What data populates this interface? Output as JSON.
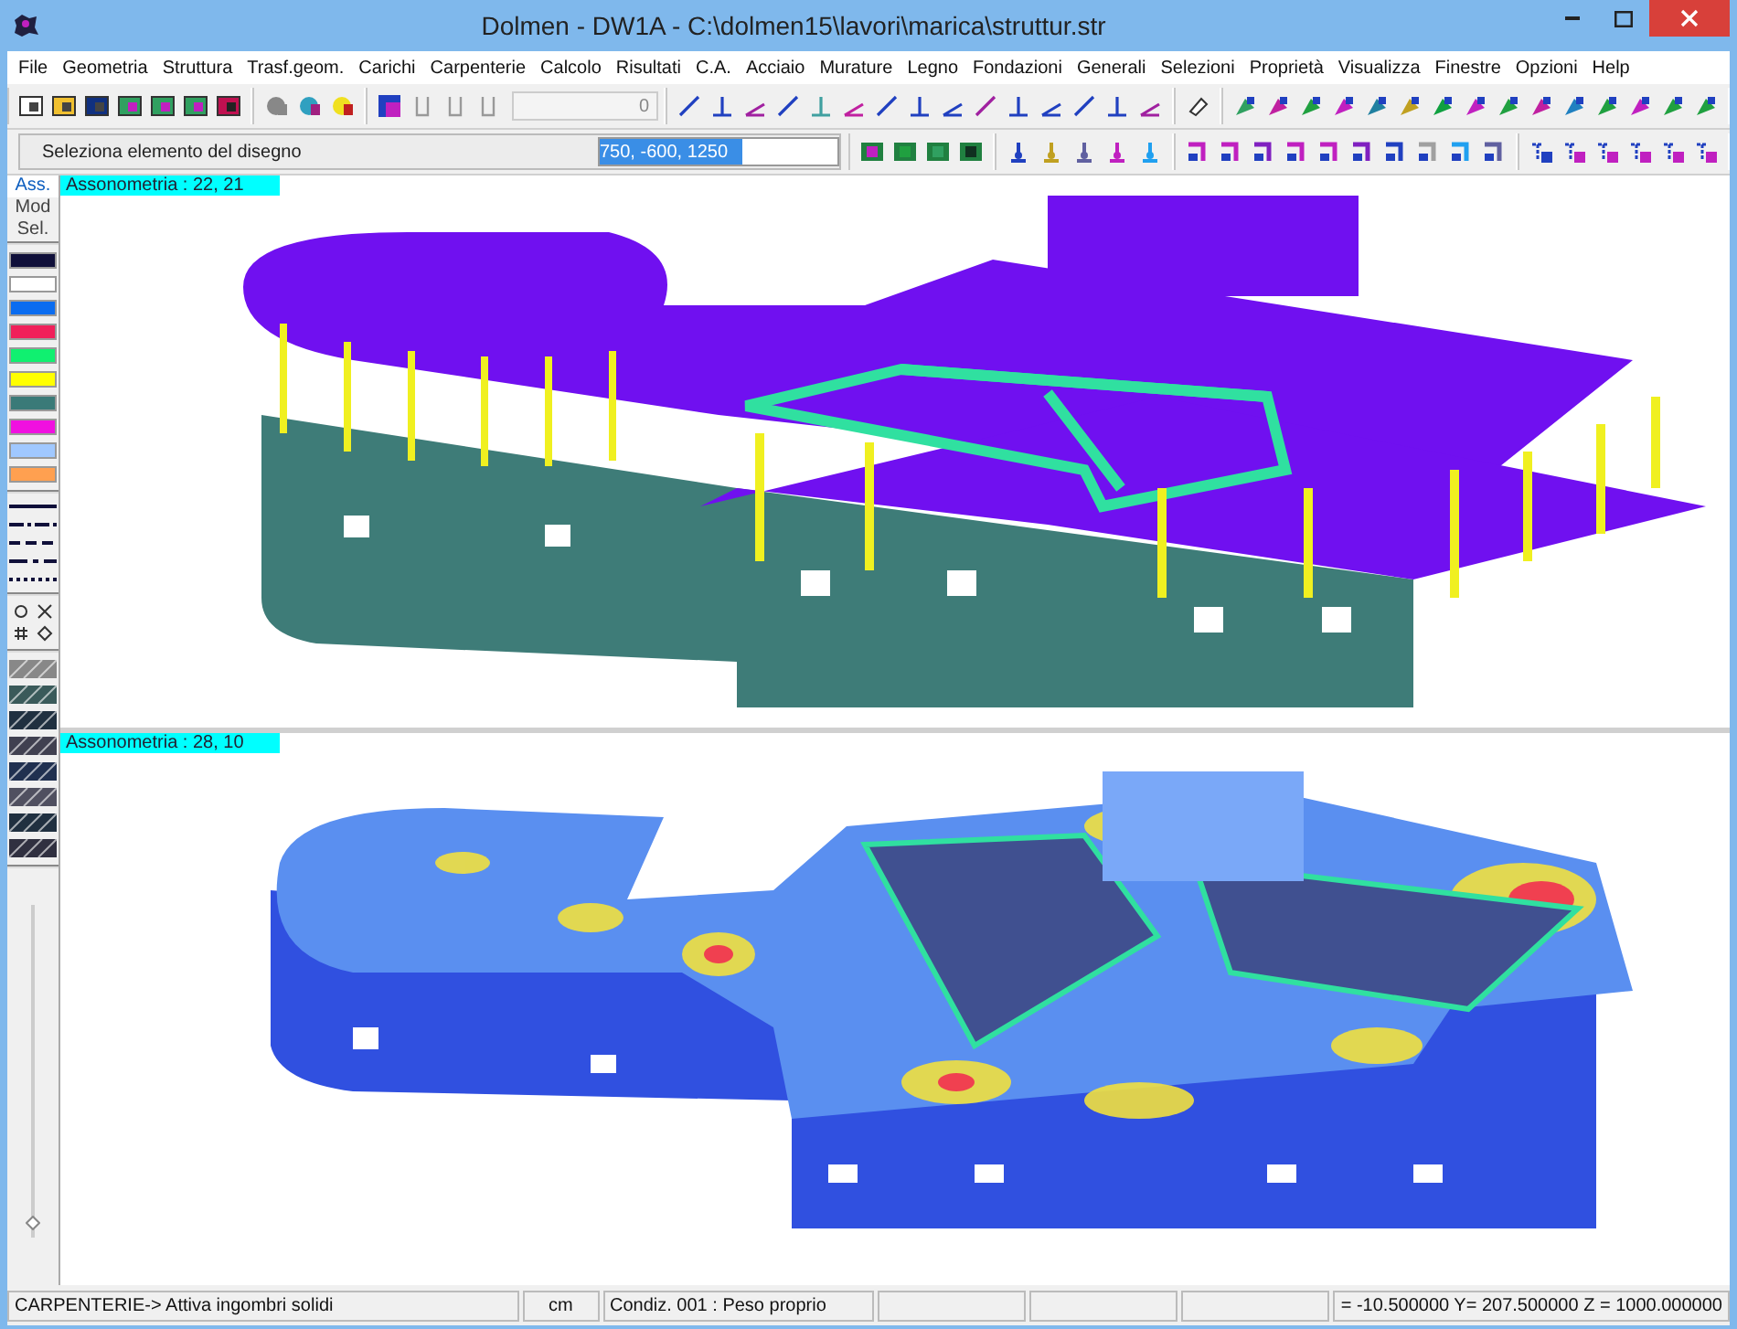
{
  "window": {
    "title": "Dolmen - DW1A - C:\\dolmen15\\lavori\\marica\\struttur.str"
  },
  "menu": [
    "File",
    "Geometria",
    "Struttura",
    "Trasf.geom.",
    "Carichi",
    "Carpenterie",
    "Calcolo",
    "Risultati",
    "C.A.",
    "Acciaio",
    "Murature",
    "Legno",
    "Fondazioni",
    "Generali",
    "Selezioni",
    "Proprietà",
    "Visualizza",
    "Finestre",
    "Opzioni",
    "Help"
  ],
  "toolbar": {
    "counter": "0"
  },
  "command_bar": {
    "hint": "Seleziona  elemento del disegno",
    "coordinates": "750, -600, 1250"
  },
  "palette": {
    "tabs": [
      {
        "label": "Ass.",
        "selected": true
      },
      {
        "label": "Mod",
        "selected": false
      },
      {
        "label": "Sel.",
        "selected": false
      }
    ],
    "colors": [
      {
        "color": "#10103a"
      },
      {
        "color": "#ffffff"
      },
      {
        "color": "#0a6cf0"
      },
      {
        "color": "#f0205a"
      },
      {
        "color": "#10f070"
      },
      {
        "color": "#ffff00"
      },
      {
        "color": "#3a7a78"
      },
      {
        "color": "#f010e0"
      },
      {
        "color": "#a0c8ff"
      },
      {
        "color": "#ffa050"
      }
    ]
  },
  "zoom_slider": {
    "level": 0.05
  },
  "viewports": [
    {
      "label": "Assonometria  :  22, 21",
      "kind": "model"
    },
    {
      "label": "Assonometria  :  28, 10",
      "kind": "contour"
    }
  ],
  "status_bar": {
    "message": "CARPENTERIE-> Attiva ingombri solidi",
    "units": "cm",
    "condition": "Condiz. 001 : Peso proprio",
    "coordinates": "= -10.500000 Y= 207.500000 Z = 1000.000000"
  }
}
